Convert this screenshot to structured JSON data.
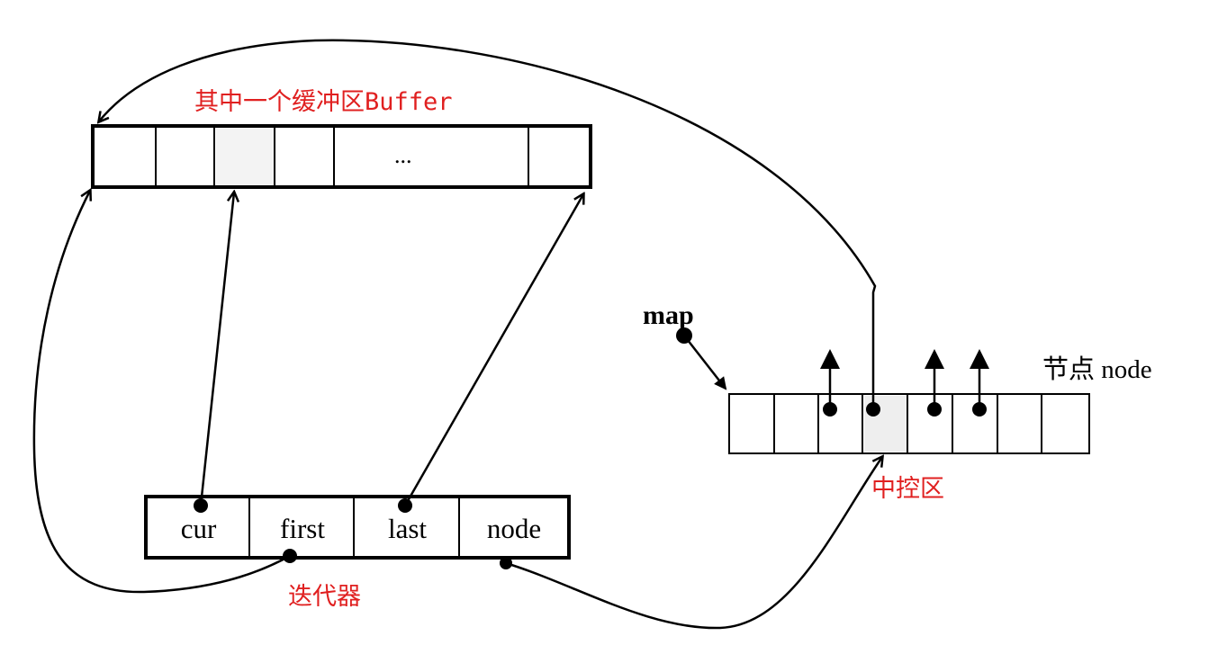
{
  "buffer": {
    "title": "其中一个缓冲区Buffer",
    "ellipsis": "..."
  },
  "iterator": {
    "fields": [
      "cur",
      "first",
      "last",
      "node"
    ],
    "label": "迭代器"
  },
  "map": {
    "label": "map",
    "node_label": "节点 node",
    "control_label": "中控区"
  },
  "colors": {
    "annotation": "#e02020",
    "line": "#000000"
  }
}
